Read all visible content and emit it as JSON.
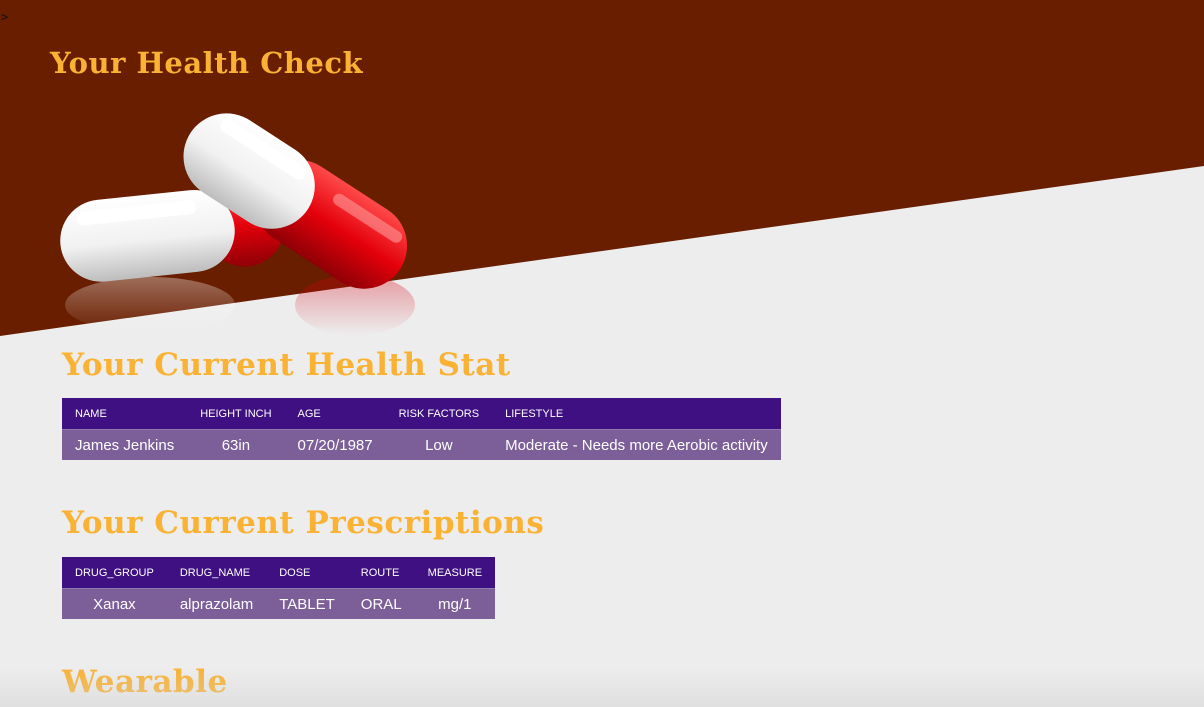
{
  "header": {
    "caret": ">",
    "title": "Your Health Check",
    "background_color": "#6a1e00",
    "title_color": "#f9b233",
    "hero_image": "red-white-capsules-image"
  },
  "health_stat": {
    "title": "Your Current Health Stat",
    "columns": [
      "NAME",
      "HEIGHT INCH",
      "AGE",
      "RISK FACTORS",
      "LIFESTYLE"
    ],
    "row": [
      "James Jenkins",
      "63in",
      "07/20/1987",
      "Low",
      "Moderate - Needs more Aerobic activity"
    ]
  },
  "prescriptions": {
    "title": "Your Current Prescriptions",
    "columns": [
      "DRUG_GROUP",
      "DRUG_NAME",
      "DOSE",
      "ROUTE",
      "MEASURE"
    ],
    "row": [
      "Xanax",
      "alprazolam",
      "TABLET",
      "ORAL",
      "mg/1"
    ]
  },
  "wearable": {
    "title": "Wearable"
  },
  "colors": {
    "table_header": "#3e1082",
    "table_row": "#7c5e98",
    "page_background": "#ededed"
  }
}
